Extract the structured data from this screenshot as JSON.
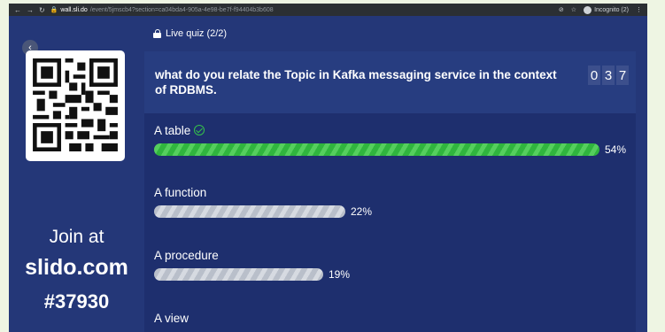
{
  "browser": {
    "url_host": "wall.sli.do",
    "url_path": "/event/5jmscb4?section=ca04bda4-905a-4e98-be7f-f94404b3b608",
    "incognito_label": "Incognito (2)"
  },
  "join": {
    "line1": "Join at",
    "line2": "slido.com",
    "code": "#37930"
  },
  "quiz": {
    "live_label": "Live quiz (2/2)",
    "question": "what do you relate the Topic in Kafka messaging service in the context of RDBMS.",
    "timer_digits": [
      "0",
      "3",
      "7"
    ]
  },
  "answers": [
    {
      "label": "A table",
      "percent_text": "54%",
      "fraction": 1.0,
      "correct": true
    },
    {
      "label": "A function",
      "percent_text": "22%",
      "fraction": 0.43,
      "correct": false
    },
    {
      "label": "A procedure",
      "percent_text": "19%",
      "fraction": 0.38,
      "correct": false
    },
    {
      "label": "A view",
      "percent_text": "",
      "fraction": 0,
      "correct": false
    }
  ],
  "colors": {
    "page_bg": "#243778",
    "correct_bar": "#30b53e",
    "other_bar": "#c8ccd5"
  }
}
